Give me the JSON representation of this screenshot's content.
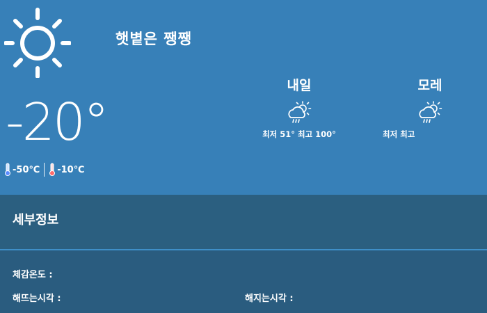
{
  "current": {
    "condition": "햇볕은 쨍쨍",
    "temperature": "-20°",
    "min_temp": "-50℃",
    "max_temp": "-10℃",
    "icon": "sun-icon"
  },
  "forecast": [
    {
      "day": "내일",
      "icon": "cloud-sun-rain-icon",
      "range": "최저 51° 최고 100°"
    },
    {
      "day": "모레",
      "icon": "cloud-sun-rain-icon",
      "range": "최저 최고"
    }
  ],
  "details": {
    "title": "세부정보",
    "feels_like_label": "체감온도 :",
    "sunrise_label": "해뜨는시각 :",
    "sunset_label": "해지는시각 :"
  },
  "colors": {
    "top_bg": "#3780b8",
    "details_bg": "#2a5c7f",
    "divider": "#3f8fc8"
  }
}
